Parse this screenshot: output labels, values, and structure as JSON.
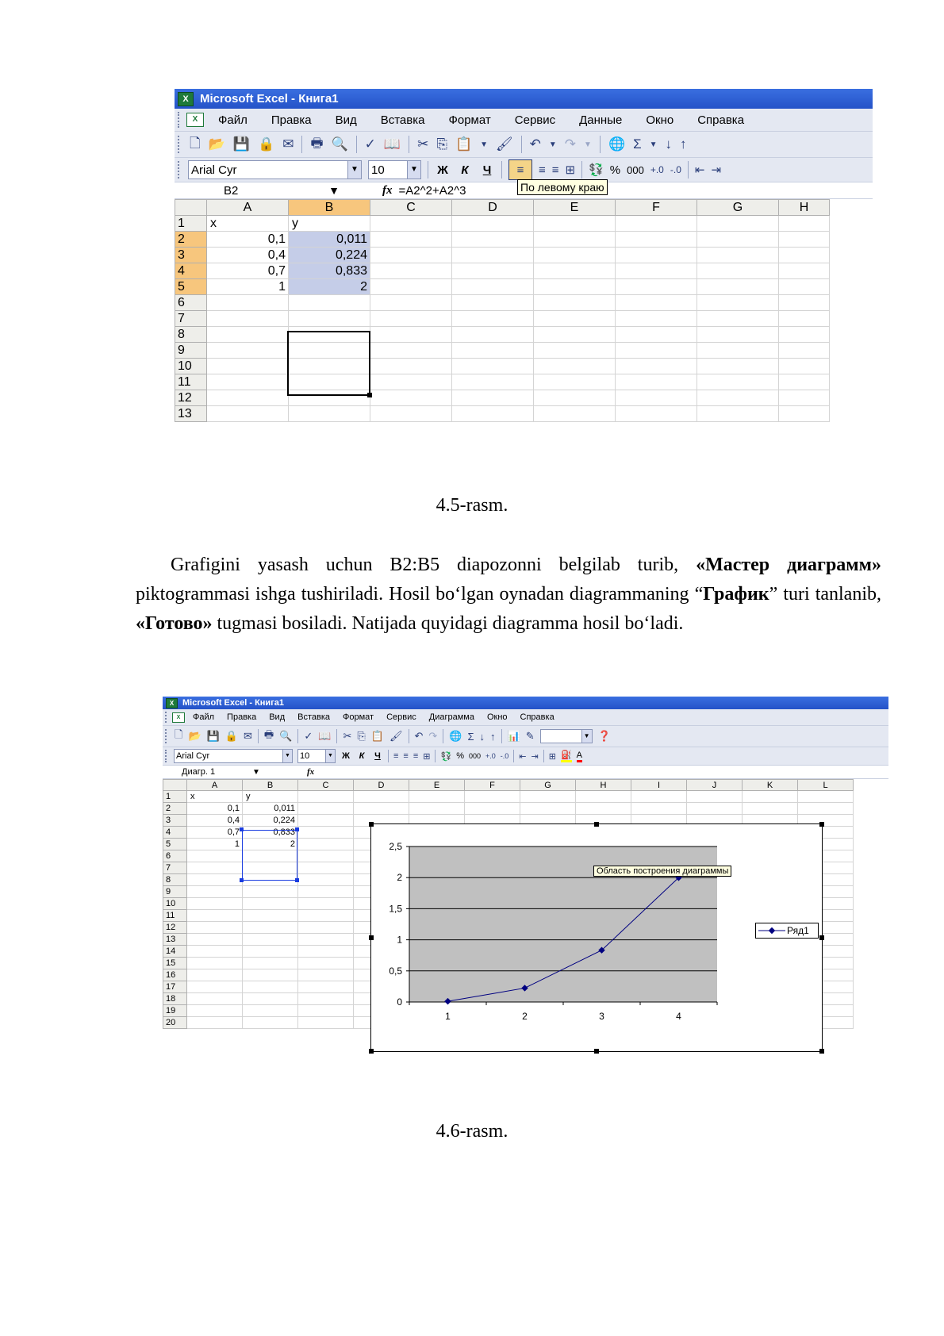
{
  "fig1": {
    "window_title": "Microsoft Excel - Книга1",
    "menu": [
      "Файл",
      "Правка",
      "Вид",
      "Вставка",
      "Формат",
      "Сервис",
      "Данные",
      "Окно",
      "Справка"
    ],
    "font_name": "Arial Cyr",
    "font_size": "10",
    "format_buttons": [
      "Ж",
      "К",
      "Ч"
    ],
    "percent": "%",
    "thousands": "000",
    "name_box": "B2",
    "fx": "fx",
    "formula": "=A2^2+A2^3",
    "tooltip": "По левому краю",
    "columns": [
      "A",
      "B",
      "C",
      "D",
      "E",
      "F",
      "G",
      "H"
    ],
    "rows": [
      {
        "n": "1",
        "a": "x",
        "b": "y"
      },
      {
        "n": "2",
        "a": "0,1",
        "b": "0,011"
      },
      {
        "n": "3",
        "a": "0,4",
        "b": "0,224"
      },
      {
        "n": "4",
        "a": "0,7",
        "b": "0,833"
      },
      {
        "n": "5",
        "a": "1",
        "b": "2"
      },
      {
        "n": "6",
        "a": "",
        "b": ""
      },
      {
        "n": "7",
        "a": "",
        "b": ""
      },
      {
        "n": "8",
        "a": "",
        "b": ""
      },
      {
        "n": "9",
        "a": "",
        "b": ""
      },
      {
        "n": "10",
        "a": "",
        "b": ""
      },
      {
        "n": "11",
        "a": "",
        "b": ""
      },
      {
        "n": "12",
        "a": "",
        "b": ""
      },
      {
        "n": "13",
        "a": "",
        "b": ""
      }
    ],
    "caption": "4.5-rasm."
  },
  "paragraph": {
    "p1": "Grafigini yasash uchun B2:B5 diapozonni belgilab turib, ",
    "b1": "«Мастер диаграмм»",
    "p2": " piktogrammasi ishga tushiriladi. Hosil bo‘lgan oynadan diagrammaning “",
    "b2": "График",
    "p3": "” turi tanlanib, ",
    "b3": "«Готово»",
    "p4": " tugmasi bosiladi. Natijada quyidagi diagramma hosil bo‘ladi."
  },
  "fig2": {
    "window_title": "Microsoft Excel - Книга1",
    "menu": [
      "Файл",
      "Правка",
      "Вид",
      "Вставка",
      "Формат",
      "Сервис",
      "Диаграмма",
      "Окно",
      "Справка"
    ],
    "font_name": "Arial Cyr",
    "font_size": "10",
    "format_buttons": [
      "Ж",
      "К",
      "Ч"
    ],
    "percent": "%",
    "thousands": "000",
    "name_box": "Диагр. 1",
    "fx": "fx",
    "columns": [
      "A",
      "B",
      "C",
      "D",
      "E",
      "F",
      "G",
      "H",
      "I",
      "J",
      "K",
      "L"
    ],
    "rows": [
      {
        "n": "1",
        "a": "x",
        "b": "y"
      },
      {
        "n": "2",
        "a": "0,1",
        "b": "0,011"
      },
      {
        "n": "3",
        "a": "0,4",
        "b": "0,224"
      },
      {
        "n": "4",
        "a": "0,7",
        "b": "0,833"
      },
      {
        "n": "5",
        "a": "1",
        "b": "2"
      },
      {
        "n": "6",
        "a": "",
        "b": ""
      },
      {
        "n": "7",
        "a": "",
        "b": ""
      },
      {
        "n": "8",
        "a": "",
        "b": ""
      },
      {
        "n": "9",
        "a": "",
        "b": ""
      },
      {
        "n": "10",
        "a": "",
        "b": ""
      },
      {
        "n": "11",
        "a": "",
        "b": ""
      },
      {
        "n": "12",
        "a": "",
        "b": ""
      },
      {
        "n": "13",
        "a": "",
        "b": ""
      },
      {
        "n": "14",
        "a": "",
        "b": ""
      },
      {
        "n": "15",
        "a": "",
        "b": ""
      },
      {
        "n": "16",
        "a": "",
        "b": ""
      },
      {
        "n": "17",
        "a": "",
        "b": ""
      },
      {
        "n": "18",
        "a": "",
        "b": ""
      },
      {
        "n": "19",
        "a": "",
        "b": ""
      },
      {
        "n": "20",
        "a": "",
        "b": ""
      }
    ],
    "tooltip": "Область построения диаграммы",
    "caption": "4.6-rasm."
  },
  "chart_data": {
    "type": "line",
    "categories": [
      "1",
      "2",
      "3",
      "4"
    ],
    "series": [
      {
        "name": "Ряд1",
        "values": [
          0.011,
          0.224,
          0.833,
          2
        ]
      }
    ],
    "y_ticks": [
      "0",
      "0,5",
      "1",
      "1,5",
      "2",
      "2,5"
    ],
    "ylim": [
      0,
      2.5
    ],
    "grid": true,
    "legend": "right",
    "plot_bg": "#c0c0c0",
    "line_color": "#000080"
  }
}
